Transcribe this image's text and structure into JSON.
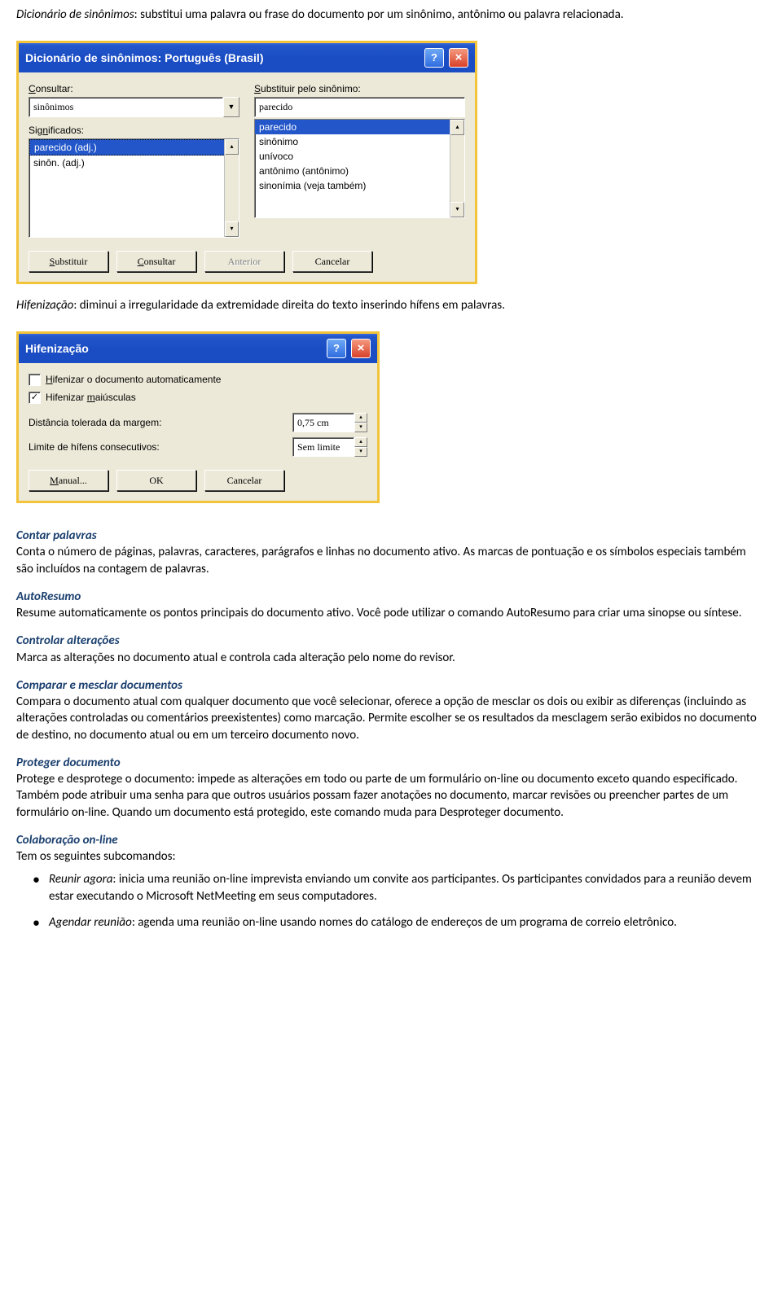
{
  "intro": {
    "label": "Dicionário de sinônimos",
    "text": ": substitui uma palavra ou frase do documento por um sinônimo, antônimo ou palavra relacionada."
  },
  "dialog1": {
    "title": "Dicionário de sinônimos: Português (Brasil)",
    "consultar_label": "Consultar:",
    "consultar_underline": "C",
    "consultar_value": "sinônimos",
    "substituir_label": "Substituir pelo sinônimo:",
    "substituir_underline": "S",
    "substituir_value": "parecido",
    "significados_label": "Significados:",
    "significados_underline": "n",
    "significados_items": [
      "parecido (adj.)",
      "sinôn. (adj.)"
    ],
    "sinonimos_items": [
      "parecido",
      "sinônimo",
      "unívoco",
      "antônimo (antônimo)",
      "sinonímia (veja também)"
    ],
    "btn_substituir": "Substituir",
    "btn_substituir_u": "S",
    "btn_consultar": "Consultar",
    "btn_consultar_u": "C",
    "btn_anterior": "Anterior",
    "btn_cancelar": "Cancelar"
  },
  "hifen_intro": {
    "label": "Hifenização",
    "text": ": diminui a irregularidade da extremidade direita do texto inserindo hífens em palavras."
  },
  "dialog2": {
    "title": "Hifenização",
    "chk1": "ifenizar o documento automaticamente",
    "chk1_pre": "H",
    "chk2": "Hifenizar ",
    "chk2_u": "m",
    "chk2_post": "aiúsculas",
    "dist_label": "Distância tolerada da margem:",
    "dist_value": "0,75 cm",
    "limite_label": "Limite de hífens consecutivos:",
    "limite_value": "Sem limite",
    "btn_manual": "Manual...",
    "btn_manual_u": "M",
    "btn_ok": "OK",
    "btn_cancelar": "Cancelar"
  },
  "sections": {
    "contar_title": "Contar palavras",
    "contar_text": "Conta o número de páginas, palavras, caracteres, parágrafos e linhas no documento ativo. As marcas de pontuação e os símbolos especiais também são incluídos na contagem de palavras.",
    "autoresumo_title": "AutoResumo",
    "autoresumo_text": "Resume automaticamente os pontos principais do documento ativo. Você pode utilizar o comando AutoResumo para criar uma sinopse ou síntese.",
    "controlar_title": "Controlar alterações",
    "controlar_text": "Marca as alterações no documento atual e controla cada alteração pelo nome do revisor.",
    "comparar_title": "Comparar e mesclar documentos",
    "comparar_text": "Compara o documento atual com qualquer documento que você selecionar, oferece a opção de mesclar os dois ou exibir as diferenças (incluindo as alterações controladas ou comentários preexistentes) como marcação. Permite escolher se os resultados da mesclagem serão exibidos no documento de destino, no documento atual ou em um terceiro documento novo.",
    "proteger_title": "Proteger documento",
    "proteger_text": "Protege e desprotege o documento: impede as alterações em todo ou parte de um formulário on-line ou documento exceto quando especificado. Também pode atribuir uma senha para que outros usuários possam fazer anotações no documento, marcar revisões ou preencher partes de um formulário on-line. Quando um documento está protegido, este comando muda para Desproteger documento.",
    "colab_title": "Colaboração on-line",
    "colab_intro": "Tem os seguintes subcomandos:",
    "colab_items": [
      {
        "label": "Reunir agora",
        "text": ": inicia uma reunião on-line imprevista enviando um convite aos participantes. Os participantes convidados para a reunião devem estar executando o Microsoft NetMeeting em seus computadores."
      },
      {
        "label": "Agendar reunião",
        "text": ": agenda uma reunião on-line usando nomes do catálogo de endereços de um programa de correio eletrônico."
      }
    ]
  }
}
